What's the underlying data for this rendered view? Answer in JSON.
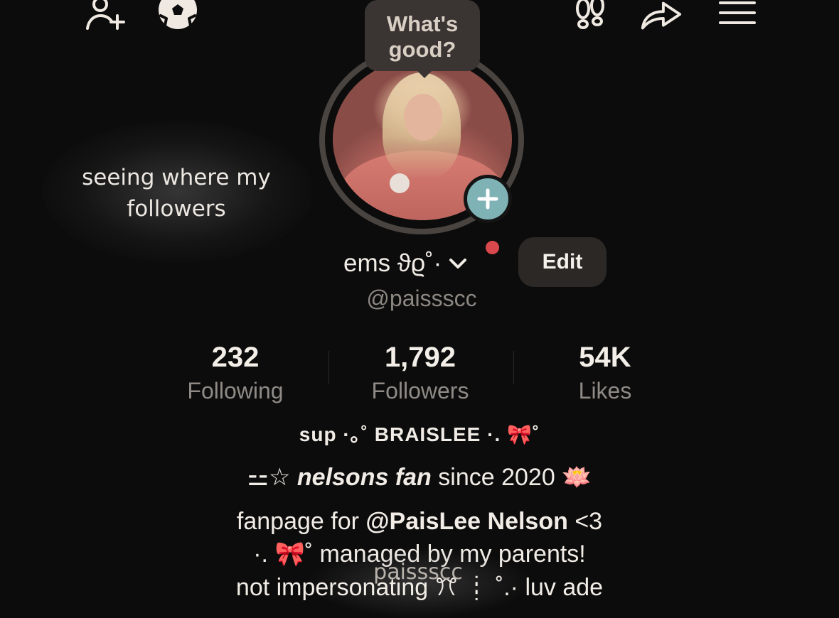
{
  "header": {
    "icons": [
      "add-friend-icon",
      "soccer-ball-icon",
      "footprints-icon",
      "share-icon",
      "menu-icon"
    ]
  },
  "tooltip": {
    "line1": "What's",
    "line2": "good?"
  },
  "note": {
    "line1": "seeing where my",
    "line2": "followers"
  },
  "profile": {
    "name": "ems ϑϱ˚·",
    "handle": "@paissscc",
    "edit_label": "Edit"
  },
  "stats": [
    {
      "value": "232",
      "label": "Following"
    },
    {
      "value": "1,792",
      "label": "Followers"
    },
    {
      "value": "54K",
      "label": "Likes"
    }
  ],
  "bio": {
    "line1": "sup ·｡˚ BRAISLEE ·. 🎀˚",
    "line2_prefix": "⚍☆ ",
    "line2_italic": "nelsons fan",
    "line2_suffix": " since 2020 🪷",
    "line3_prefix": "fanpage for ",
    "line3_bold": "@PaisLee Nelson",
    "line3_suffix": "  <3",
    "line4": "·. 🎀˚ managed by my parents!",
    "line5_prefix": "not impersonating ",
    "line5_suffix": "ꔫ ┊ ˚.· luv ade"
  },
  "watermark": "paissscc",
  "colors": {
    "background": "#0c0c0c",
    "plus_badge": "#7fb2b5",
    "notification_dot": "#d8484d",
    "edit_button": "#2c2826"
  }
}
